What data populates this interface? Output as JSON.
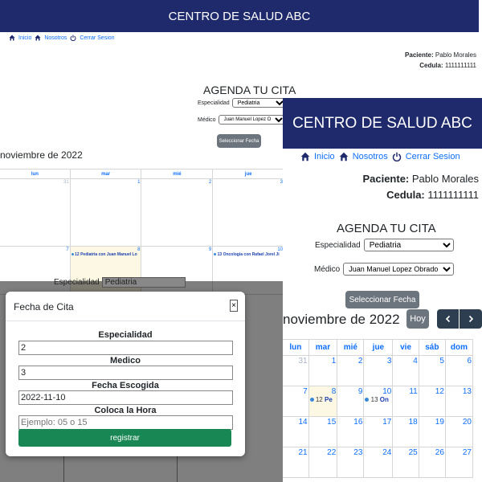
{
  "app_title": "CENTRO DE SALUD ABC",
  "nav": {
    "home": "Inicio",
    "about": "Nosotros",
    "logout": "Cerrar Sesion"
  },
  "patient": {
    "name_label": "Paciente:",
    "name": "Pablo Morales",
    "id_label": "Cedula:",
    "id": "1111111111"
  },
  "agenda": {
    "title": "AGENDA TU CITA",
    "specialty_label": "Especialidad",
    "specialty_value": "Pediatria",
    "doctor_label": "Médico",
    "doctor_value": "Juan Manuel Lopez Obrador",
    "submit_label": "Seleccionar Fecha"
  },
  "calendar": {
    "title": "noviembre de 2022",
    "today_button": "Hoy",
    "prev_icon": "chevron-left-icon",
    "next_icon": "chevron-right-icon",
    "back_weekdays": [
      "lun",
      "mar",
      "mié",
      "jue"
    ],
    "back_row1": [
      "31",
      "1",
      "2",
      "3"
    ],
    "back_row2": [
      "7",
      "8",
      "9",
      "10"
    ],
    "front_weekdays": [
      "lun",
      "mar",
      "mié",
      "jue",
      "vie",
      "sáb",
      "dom"
    ],
    "front_rows": [
      [
        "31",
        "1",
        "2",
        "3",
        "4",
        "5",
        "6"
      ],
      [
        "7",
        "8",
        "9",
        "10",
        "11",
        "12",
        "13"
      ],
      [
        "14",
        "15",
        "16",
        "17",
        "18",
        "19",
        "20"
      ],
      [
        "21",
        "22",
        "23",
        "24",
        "25",
        "26",
        "27"
      ]
    ],
    "events": {
      "tue8_back": "12 Pediatria con Juan Manuel Lo",
      "thu10_back": "13 Oncologia con Rafael Jorel Ji",
      "tue8_front_num": "12",
      "tue8_front_text": "Pe",
      "thu10_front_num": "13",
      "thu10_front_text": "On"
    }
  },
  "modal": {
    "title": "Fecha de Cita",
    "close_label": "×",
    "specialty_label": "Especialidad",
    "specialty_value": "2",
    "doctor_label": "Medico",
    "doctor_value": "3",
    "date_label": "Fecha Escogida",
    "date_value": "2022-11-10",
    "hour_label": "Coloca la Hora",
    "hour_placeholder": "Ejemplo: 05 o 15",
    "submit_label": "registrar"
  },
  "behind_modal": {
    "specialty_label": "Especialidad",
    "specialty_value": "Pediatria"
  },
  "colors": {
    "header": "#1f2a6d",
    "today_bg": "#fcf8e3",
    "link": "#0d6efd",
    "submit_green": "#198754",
    "event_dot": "#3788d8"
  }
}
